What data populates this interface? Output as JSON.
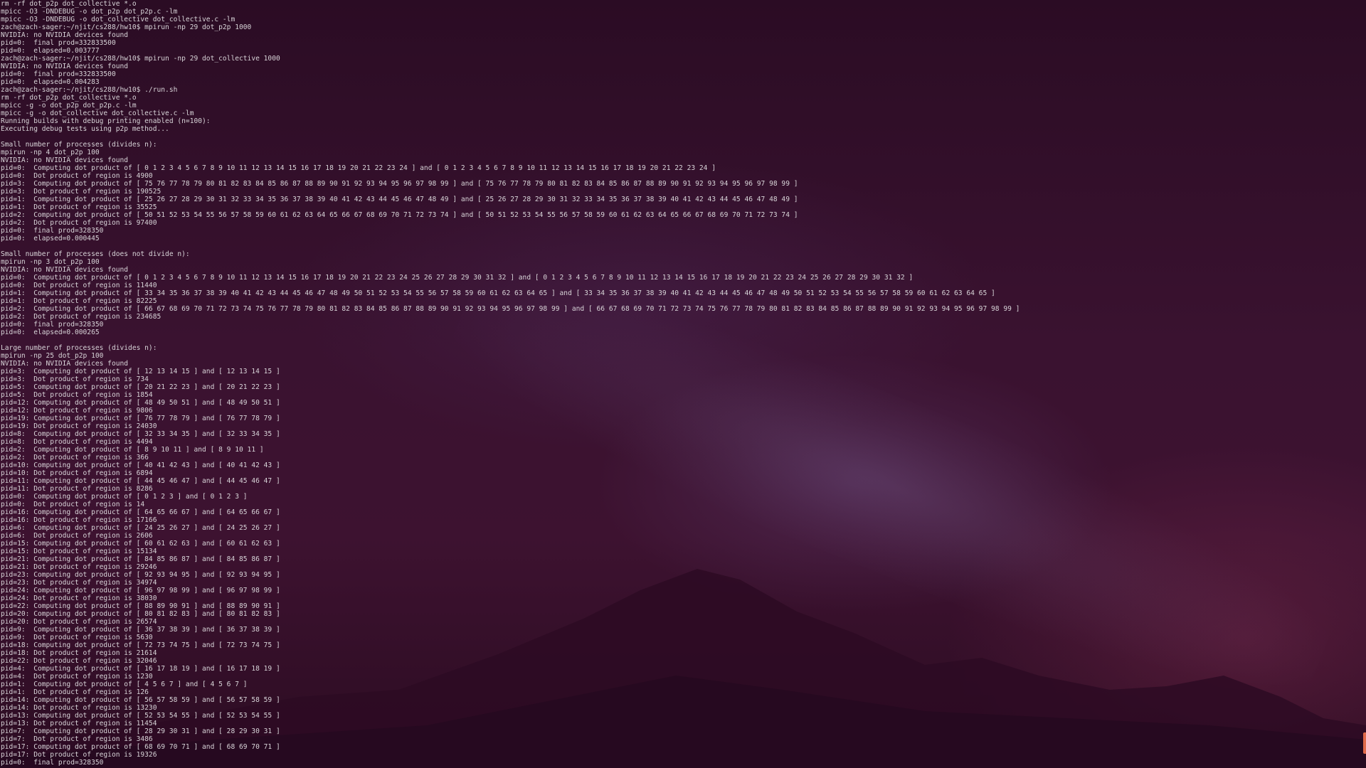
{
  "terminal": {
    "lines": [
      "rm -rf dot_p2p dot_collective *.o",
      "mpicc -O3 -DNDEBUG -o dot_p2p dot_p2p.c -lm",
      "mpicc -O3 -DNDEBUG -o dot_collective dot_collective.c -lm",
      "zach@zach-sager:~/njit/cs288/hw10$ mpirun -np 29 dot_p2p 1000",
      "NVIDIA: no NVIDIA devices found",
      "pid=0:  final prod=332833500",
      "pid=0:  elapsed=0.003777",
      "zach@zach-sager:~/njit/cs288/hw10$ mpirun -np 29 dot_collective 1000",
      "NVIDIA: no NVIDIA devices found",
      "pid=0:  final prod=332833500",
      "pid=0:  elapsed=0.004283",
      "zach@zach-sager:~/njit/cs288/hw10$ ./run.sh",
      "rm -rf dot_p2p dot_collective *.o",
      "mpicc -g -o dot_p2p dot_p2p.c -lm",
      "mpicc -g -o dot_collective dot_collective.c -lm",
      "Running builds with debug printing enabled (n=100):",
      "Executing debug tests using p2p method...",
      "",
      "Small number of processes (divides n):",
      "mpirun -np 4 dot_p2p 100",
      "NVIDIA: no NVIDIA devices found",
      "pid=0:  Computing dot product of [ 0 1 2 3 4 5 6 7 8 9 10 11 12 13 14 15 16 17 18 19 20 21 22 23 24 ] and [ 0 1 2 3 4 5 6 7 8 9 10 11 12 13 14 15 16 17 18 19 20 21 22 23 24 ]",
      "pid=0:  Dot product of region is 4900",
      "pid=3:  Computing dot product of [ 75 76 77 78 79 80 81 82 83 84 85 86 87 88 89 90 91 92 93 94 95 96 97 98 99 ] and [ 75 76 77 78 79 80 81 82 83 84 85 86 87 88 89 90 91 92 93 94 95 96 97 98 99 ]",
      "pid=3:  Dot product of region is 190525",
      "pid=1:  Computing dot product of [ 25 26 27 28 29 30 31 32 33 34 35 36 37 38 39 40 41 42 43 44 45 46 47 48 49 ] and [ 25 26 27 28 29 30 31 32 33 34 35 36 37 38 39 40 41 42 43 44 45 46 47 48 49 ]",
      "pid=1:  Dot product of region is 35525",
      "pid=2:  Computing dot product of [ 50 51 52 53 54 55 56 57 58 59 60 61 62 63 64 65 66 67 68 69 70 71 72 73 74 ] and [ 50 51 52 53 54 55 56 57 58 59 60 61 62 63 64 65 66 67 68 69 70 71 72 73 74 ]",
      "pid=2:  Dot product of region is 97400",
      "pid=0:  final prod=328350",
      "pid=0:  elapsed=0.000445",
      "",
      "Small number of processes (does not divide n):",
      "mpirun -np 3 dot_p2p 100",
      "NVIDIA: no NVIDIA devices found",
      "pid=0:  Computing dot product of [ 0 1 2 3 4 5 6 7 8 9 10 11 12 13 14 15 16 17 18 19 20 21 22 23 24 25 26 27 28 29 30 31 32 ] and [ 0 1 2 3 4 5 6 7 8 9 10 11 12 13 14 15 16 17 18 19 20 21 22 23 24 25 26 27 28 29 30 31 32 ]",
      "pid=0:  Dot product of region is 11440",
      "pid=1:  Computing dot product of [ 33 34 35 36 37 38 39 40 41 42 43 44 45 46 47 48 49 50 51 52 53 54 55 56 57 58 59 60 61 62 63 64 65 ] and [ 33 34 35 36 37 38 39 40 41 42 43 44 45 46 47 48 49 50 51 52 53 54 55 56 57 58 59 60 61 62 63 64 65 ]",
      "pid=1:  Dot product of region is 82225",
      "pid=2:  Computing dot product of [ 66 67 68 69 70 71 72 73 74 75 76 77 78 79 80 81 82 83 84 85 86 87 88 89 90 91 92 93 94 95 96 97 98 99 ] and [ 66 67 68 69 70 71 72 73 74 75 76 77 78 79 80 81 82 83 84 85 86 87 88 89 90 91 92 93 94 95 96 97 98 99 ]",
      "pid=2:  Dot product of region is 234685",
      "pid=0:  final prod=328350",
      "pid=0:  elapsed=0.000265",
      "",
      "Large number of processes (divides n):",
      "mpirun -np 25 dot_p2p 100",
      "NVIDIA: no NVIDIA devices found",
      "pid=3:  Computing dot product of [ 12 13 14 15 ] and [ 12 13 14 15 ]",
      "pid=3:  Dot product of region is 734",
      "pid=5:  Computing dot product of [ 20 21 22 23 ] and [ 20 21 22 23 ]",
      "pid=5:  Dot product of region is 1854",
      "pid=12: Computing dot product of [ 48 49 50 51 ] and [ 48 49 50 51 ]",
      "pid=12: Dot product of region is 9806",
      "pid=19: Computing dot product of [ 76 77 78 79 ] and [ 76 77 78 79 ]",
      "pid=19: Dot product of region is 24030",
      "pid=8:  Computing dot product of [ 32 33 34 35 ] and [ 32 33 34 35 ]",
      "pid=8:  Dot product of region is 4494",
      "pid=2:  Computing dot product of [ 8 9 10 11 ] and [ 8 9 10 11 ]",
      "pid=2:  Dot product of region is 366",
      "pid=10: Computing dot product of [ 40 41 42 43 ] and [ 40 41 42 43 ]",
      "pid=10: Dot product of region is 6894",
      "pid=11: Computing dot product of [ 44 45 46 47 ] and [ 44 45 46 47 ]",
      "pid=11: Dot product of region is 8286",
      "pid=0:  Computing dot product of [ 0 1 2 3 ] and [ 0 1 2 3 ]",
      "pid=0:  Dot product of region is 14",
      "pid=16: Computing dot product of [ 64 65 66 67 ] and [ 64 65 66 67 ]",
      "pid=16: Dot product of region is 17166",
      "pid=6:  Computing dot product of [ 24 25 26 27 ] and [ 24 25 26 27 ]",
      "pid=6:  Dot product of region is 2606",
      "pid=15: Computing dot product of [ 60 61 62 63 ] and [ 60 61 62 63 ]",
      "pid=15: Dot product of region is 15134",
      "pid=21: Computing dot product of [ 84 85 86 87 ] and [ 84 85 86 87 ]",
      "pid=21: Dot product of region is 29246",
      "pid=23: Computing dot product of [ 92 93 94 95 ] and [ 92 93 94 95 ]",
      "pid=23: Dot product of region is 34974",
      "pid=24: Computing dot product of [ 96 97 98 99 ] and [ 96 97 98 99 ]",
      "pid=24: Dot product of region is 38030",
      "pid=22: Computing dot product of [ 88 89 90 91 ] and [ 88 89 90 91 ]",
      "pid=20: Computing dot product of [ 80 81 82 83 ] and [ 80 81 82 83 ]",
      "pid=20: Dot product of region is 26574",
      "pid=9:  Computing dot product of [ 36 37 38 39 ] and [ 36 37 38 39 ]",
      "pid=9:  Dot product of region is 5630",
      "pid=18: Computing dot product of [ 72 73 74 75 ] and [ 72 73 74 75 ]",
      "pid=18: Dot product of region is 21614",
      "pid=22: Dot product of region is 32046",
      "pid=4:  Computing dot product of [ 16 17 18 19 ] and [ 16 17 18 19 ]",
      "pid=4:  Dot product of region is 1230",
      "pid=1:  Computing dot product of [ 4 5 6 7 ] and [ 4 5 6 7 ]",
      "pid=1:  Dot product of region is 126",
      "pid=14: Computing dot product of [ 56 57 58 59 ] and [ 56 57 58 59 ]",
      "pid=14: Dot product of region is 13230",
      "pid=13: Computing dot product of [ 52 53 54 55 ] and [ 52 53 54 55 ]",
      "pid=13: Dot product of region is 11454",
      "pid=7:  Computing dot product of [ 28 29 30 31 ] and [ 28 29 30 31 ]",
      "pid=7:  Dot product of region is 3486",
      "pid=17: Computing dot product of [ 68 69 70 71 ] and [ 68 69 70 71 ]",
      "pid=17: Dot product of region is 19326",
      "pid=0:  final prod=328350"
    ]
  }
}
